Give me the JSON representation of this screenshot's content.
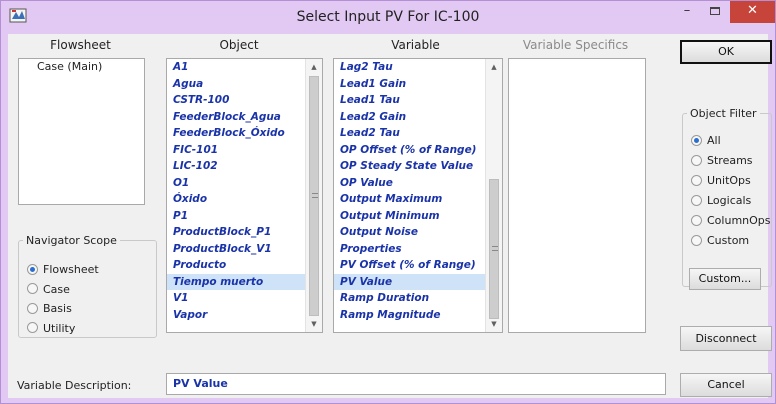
{
  "window": {
    "title": "Select Input PV For IC-100",
    "minimize": "–",
    "close": "✕"
  },
  "headers": {
    "flowsheet": "Flowsheet",
    "object": "Object",
    "variable": "Variable",
    "variable_specifics": "Variable Specifics"
  },
  "flowsheet_list": [
    "Case (Main)"
  ],
  "object_list": [
    "A1",
    "Agua",
    "CSTR-100",
    "FeederBlock_Agua",
    "FeederBlock_Óxido",
    "FIC-101",
    "LIC-102",
    "O1",
    "Óxido",
    "P1",
    "ProductBlock_P1",
    "ProductBlock_V1",
    "Producto",
    "Tiempo muerto",
    "V1",
    "Vapor"
  ],
  "object_selected_index": 13,
  "variable_list": [
    "Lag2 Tau",
    "Lead1 Gain",
    "Lead1 Tau",
    "Lead2 Gain",
    "Lead2 Tau",
    "OP Offset (% of Range)",
    "OP Steady State Value",
    "OP Value",
    "Output Maximum",
    "Output Minimum",
    "Output Noise",
    "Properties",
    "PV Offset (% of Range)",
    "PV Value",
    "Ramp Duration",
    "Ramp Magnitude"
  ],
  "variable_selected_index": 13,
  "navigator_scope": {
    "legend": "Navigator Scope",
    "options": [
      "Flowsheet",
      "Case",
      "Basis",
      "Utility"
    ],
    "selected": "Flowsheet"
  },
  "object_filter": {
    "legend": "Object Filter",
    "options": [
      "All",
      "Streams",
      "UnitOps",
      "Logicals",
      "ColumnOps",
      "Custom"
    ],
    "selected": "All",
    "custom_button": "Custom..."
  },
  "buttons": {
    "ok": "OK",
    "disconnect": "Disconnect",
    "cancel": "Cancel"
  },
  "description": {
    "label": "Variable Description:",
    "value": "PV Value"
  },
  "colors": {
    "window_frame": "#e2c9f4",
    "close_button": "#c7443b",
    "item_text": "#1a33a8",
    "selection": "#cfe3f8"
  }
}
